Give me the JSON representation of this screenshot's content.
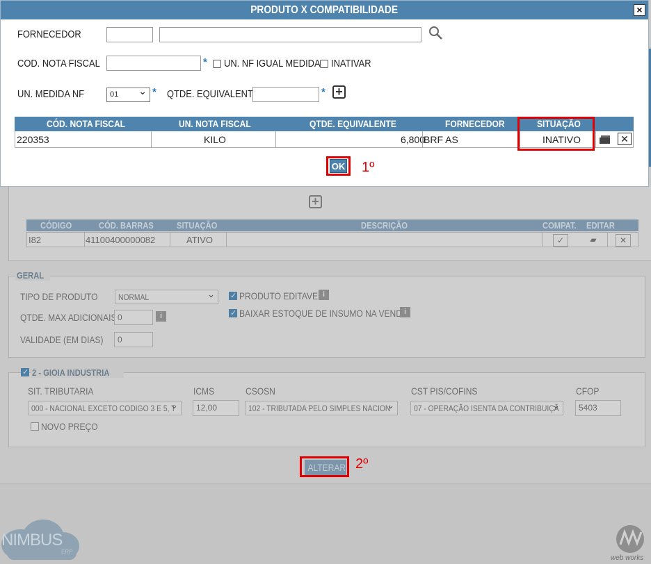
{
  "modal": {
    "title": "PRODUTO X COMPATIBILIDADE",
    "close_label": "×",
    "fornecedor_label": "FORNECEDOR",
    "fornecedor_code": "",
    "fornecedor_name": "",
    "cod_nota_label": "COD. NOTA FISCAL",
    "cod_nota_value": "",
    "required_mark": "*",
    "un_nf_igual_label": "UN. NF IGUAL MEDIDA",
    "inativar_label": "INATIVAR",
    "un_medida_label": "UN. MEDIDA NF",
    "un_medida_value": "01",
    "qtde_equiv_label": "QTDE. EQUIVALENTE",
    "qtde_equiv_value": "",
    "table": {
      "headers": [
        "CÓD. NOTA FISCAL",
        "UN. NOTA FISCAL",
        "QTDE. EQUIVALENTE",
        "FORNECEDOR",
        "SITUAÇÃO"
      ],
      "rows": [
        {
          "cod": "220353",
          "un": "KILO",
          "qtde": "6,800",
          "fornecedor": "BRF AS",
          "situacao": "INATIVO"
        }
      ]
    },
    "ok_label": "OK"
  },
  "annotations": {
    "step1": "1º",
    "step2": "2º"
  },
  "background": {
    "table": {
      "headers": [
        "CÓDIGO",
        "CÓD. BARRAS",
        "SITUAÇÃO",
        "DESCRIÇÃO",
        "COMPAT.",
        "EDITAR"
      ],
      "rows": [
        {
          "codigo": "I82",
          "barras": "41100400000082",
          "situacao": "ATIVO",
          "descricao": ""
        }
      ]
    },
    "geral": {
      "legend": "GERAL",
      "tipo_label": "TIPO DE PRODUTO",
      "tipo_value": "NORMAL",
      "qtde_max_label": "QTDE. MAX ADICIONAIS",
      "qtde_max_value": "0",
      "validade_label": "VALIDADE (EM DIAS)",
      "validade_value": "0",
      "produto_editavel_label": "PRODUTO EDITAVEL",
      "baixar_estoque_label": "BAIXAR ESTOQUE DE INSUMO NA VENDA",
      "info_glyph": "i"
    },
    "gioia": {
      "legend": "2 - GIOIA INDUSTRIA",
      "sit_label": "SIT. TRIBUTARIA",
      "sit_value": "000 - NACIONAL EXCETO CODIGO 3 E 5, T",
      "icms_label": "ICMS",
      "icms_value": "12,00",
      "csosn_label": "CSOSN",
      "csosn_value": "102 - TRIBUTADA PELO SIMPLES NACION",
      "cst_label": "CST PIS/COFINS",
      "cst_value": "07 - OPERAÇÃO ISENTA DA CONTRIBUIÇÃ",
      "cfop_label": "CFOP",
      "cfop_value": "5403",
      "novo_preco_label": "NOVO PREÇO"
    },
    "alterar_label": "ALTERAR",
    "brand_left": "NIMBUS",
    "brand_left_sub": "ERP",
    "brand_right": "web works"
  }
}
